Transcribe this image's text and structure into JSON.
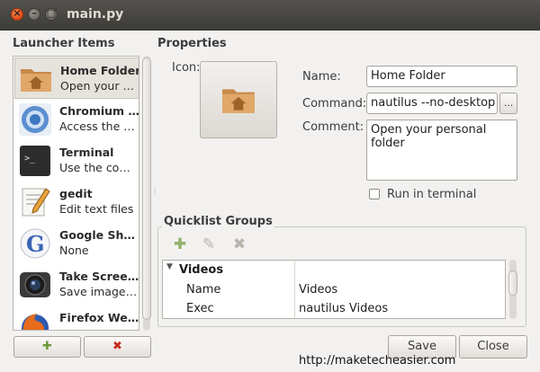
{
  "window": {
    "title": "main.py"
  },
  "titlebar": {
    "close_glyph": "×",
    "min_glyph": "–",
    "max_glyph": "□"
  },
  "launcher": {
    "heading": "Launcher Items",
    "items": [
      {
        "name": "Home Folder",
        "desc": "Open your …",
        "icon": "home-folder-icon",
        "selected": true
      },
      {
        "name": "Chromium …",
        "desc": "Access the …",
        "icon": "chromium-icon"
      },
      {
        "name": "Terminal",
        "desc": "Use the co…",
        "icon": "terminal-icon"
      },
      {
        "name": "gedit",
        "desc": "Edit text files",
        "icon": "gedit-icon"
      },
      {
        "name": "Google Sh…",
        "desc": "None",
        "icon": "google-icon"
      },
      {
        "name": "Take Scree…",
        "desc": "Save image…",
        "icon": "screenshot-icon"
      },
      {
        "name": "Firefox We…",
        "desc": "",
        "icon": "firefox-icon"
      }
    ],
    "add_glyph": "✚",
    "remove_glyph": "✖"
  },
  "properties": {
    "heading": "Properties",
    "icon_label": "Icon:",
    "name_label": "Name:",
    "name_value": "Home Folder",
    "command_label": "Command:",
    "command_value": "nautilus --no-desktop",
    "browse_label": "...",
    "comment_label": "Comment:",
    "comment_value": "Open your personal folder",
    "run_in_terminal_label": "Run in terminal",
    "run_in_terminal_checked": false
  },
  "quicklist": {
    "heading": "Quicklist Groups",
    "tools": {
      "add": "✚",
      "edit": "✎",
      "remove": "✖"
    },
    "tree": {
      "group": "Videos",
      "expander": "▼",
      "rows": [
        {
          "key": "Name",
          "value": "Videos"
        },
        {
          "key": "Exec",
          "value": "nautilus Videos"
        }
      ]
    }
  },
  "footer": {
    "save_label": "Save",
    "close_label": "Close"
  },
  "watermark": "http://maketecheasier.com",
  "colors": {
    "accent_close": "#dd4814",
    "titlebar": "#3c3b37",
    "window_bg": "#f2f1f0"
  }
}
